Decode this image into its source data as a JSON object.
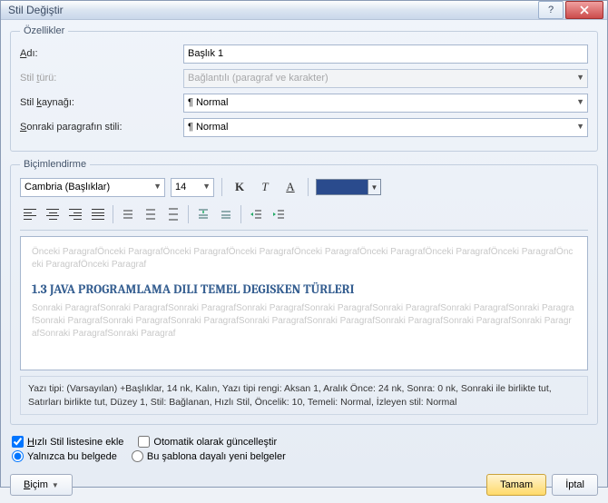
{
  "window": {
    "title": "Stil Değiştir"
  },
  "props": {
    "legend": "Özellikler",
    "name_label": "Adı:",
    "name_value": "Başlık 1",
    "type_label": "Stil türü:",
    "type_value": "Bağlantılı (paragraf ve karakter)",
    "based_label": "Stil kaynağı:",
    "based_value": "Normal",
    "next_label": "Sonraki paragrafın stili:",
    "next_value": "Normal"
  },
  "fmt": {
    "legend": "Biçimlendirme",
    "font": "Cambria (Başlıklar)",
    "size": "14"
  },
  "preview": {
    "prev_word": "Önceki Paragraf",
    "heading": "1.3 JAVA PROGRAMLAMA DILI TEMEL DEGISKEN TÜRLERI",
    "next_word": "Sonraki Paragraf"
  },
  "desc": "Yazı tipi: (Varsayılan) +Başlıklar, 14 nk, Kalın, Yazı tipi rengi: Aksan 1, Aralık Önce:  24 nk, Sonra:  0 nk, Sonraki ile birlikte tut, Satırları birlikte tut, Düzey 1, Stil: Bağlanan, Hızlı Stil, Öncelik: 10, Temeli: Normal, İzleyen stil: Normal",
  "opts": {
    "quick": "Hızlı Stil listesine ekle",
    "auto": "Otomatik olarak güncelleştir",
    "thisdoc": "Yalnızca bu belgede",
    "template": "Bu şablona dayalı yeni belgeler"
  },
  "buttons": {
    "format": "Biçim",
    "ok": "Tamam",
    "cancel": "İptal"
  }
}
